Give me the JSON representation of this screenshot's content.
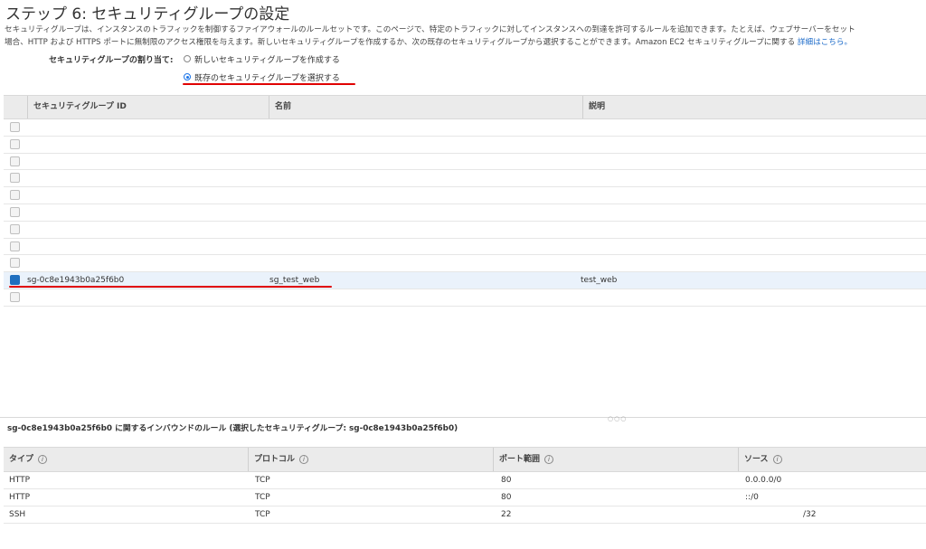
{
  "page": {
    "title": "ステップ 6: セキュリティグループの設定",
    "description_line1": "セキュリティグループは、インスタンスのトラフィックを制御するファイアウォールのルールセットです。このページで、特定のトラフィックに対してインスタンスへの到達を許可するルールを追加できます。たとえば、ウェブサーバーをセット",
    "description_line2": "場合、HTTP および HTTPS ポートに無制限のアクセス権限を与えます。新しいセキュリティグループを作成するか、次の既存のセキュリティグループから選択することができます。Amazon EC2 セキュリティグループに関する ",
    "description_link": "詳細はこちら。"
  },
  "assignment": {
    "label": "セキュリティグループの割り当て:",
    "option_new": "新しいセキュリティグループを作成する",
    "option_existing": "既存のセキュリティグループを選択する",
    "selected": "existing"
  },
  "groups_table": {
    "columns": [
      "セキュリティグループ ID",
      "名前",
      "説明"
    ],
    "rows": [
      {
        "id": "",
        "name": "",
        "desc": "",
        "selected": false
      },
      {
        "id": "",
        "name": "",
        "desc": "",
        "selected": false
      },
      {
        "id": "",
        "name": "",
        "desc": "",
        "selected": false
      },
      {
        "id": "",
        "name": "",
        "desc": "",
        "selected": false
      },
      {
        "id": "",
        "name": "",
        "desc": "",
        "selected": false
      },
      {
        "id": "",
        "name": "",
        "desc": "",
        "selected": false
      },
      {
        "id": "",
        "name": "",
        "desc": "",
        "selected": false
      },
      {
        "id": "",
        "name": "",
        "desc": "",
        "selected": false
      },
      {
        "id": "",
        "name": "",
        "desc": "",
        "selected": false
      },
      {
        "id": "sg-0c8e1943b0a25f6b0",
        "name": "sg_test_web",
        "desc": "test_web",
        "selected": true
      },
      {
        "id": "",
        "name": "",
        "desc": "",
        "selected": false
      }
    ]
  },
  "inbound": {
    "title": "sg-0c8e1943b0a25f6b0 に関するインバウンドのルール (選択したセキュリティグループ: sg-0c8e1943b0a25f6b0)",
    "columns": [
      "タイプ",
      "プロトコル",
      "ポート範囲",
      "ソース"
    ],
    "info_icon": "info-icon",
    "rows": [
      {
        "type": "HTTP",
        "protocol": "TCP",
        "port": "80",
        "source": "0.0.0.0/0"
      },
      {
        "type": "HTTP",
        "protocol": "TCP",
        "port": "80",
        "source": "::/0"
      },
      {
        "type": "SSH",
        "protocol": "TCP",
        "port": "22",
        "source": "/32"
      }
    ]
  },
  "colors": {
    "accent": "#1a73e8",
    "annotation_red": "#e00000",
    "selected_row": "#eaf2fb",
    "header_bg": "#ebebeb"
  }
}
